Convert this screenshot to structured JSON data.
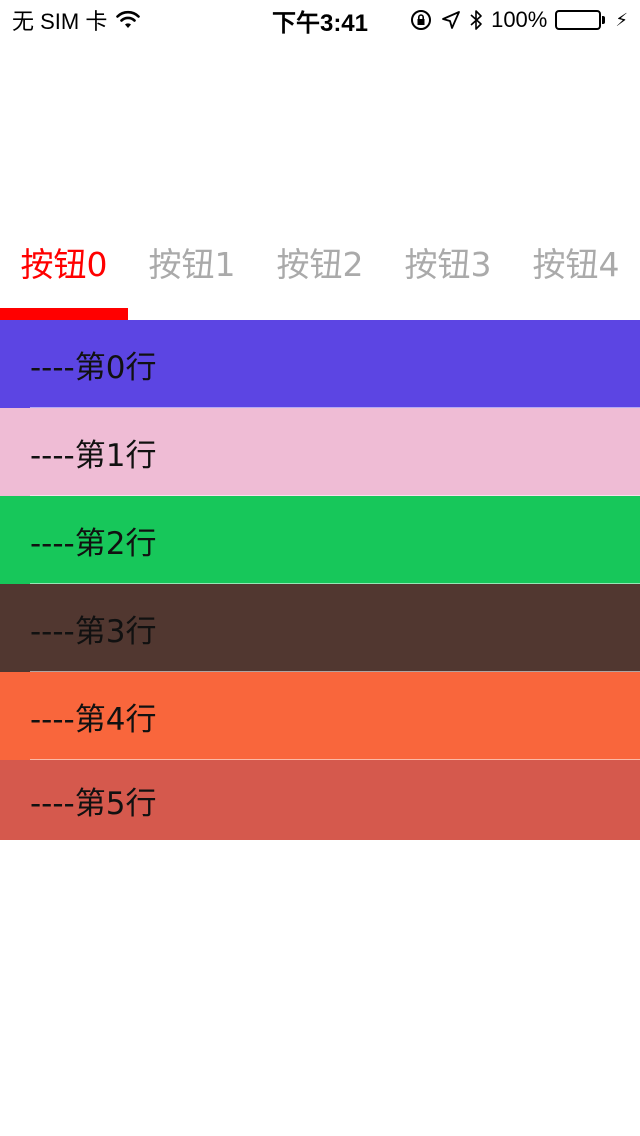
{
  "status_bar": {
    "carrier": "无 SIM 卡",
    "time": "下午3:41",
    "battery": "100%",
    "icons": [
      "wifi-icon",
      "rotation-lock-icon",
      "location-icon",
      "bluetooth-icon",
      "battery-icon",
      "charging-bolt-icon"
    ],
    "battery_level": 1.0
  },
  "tabs": [
    {
      "label": "按钮0",
      "active": true
    },
    {
      "label": "按钮1",
      "active": false
    },
    {
      "label": "按钮2",
      "active": false
    },
    {
      "label": "按钮3",
      "active": false
    },
    {
      "label": "按钮4",
      "active": false
    }
  ],
  "colors": {
    "active_tab": "#ff0000",
    "inactive_tab": "#aaaaaa",
    "indicator": "#ff0000"
  },
  "rows": [
    {
      "label": "----第0行",
      "color": "#5c45e3"
    },
    {
      "label": "----第1行",
      "color": "#efbcd5"
    },
    {
      "label": "----第2行",
      "color": "#17c75a"
    },
    {
      "label": "----第3行",
      "color": "#513730"
    },
    {
      "label": "----第4行",
      "color": "#f9663c"
    },
    {
      "label": "----第5行",
      "color": "#d5594d"
    }
  ]
}
